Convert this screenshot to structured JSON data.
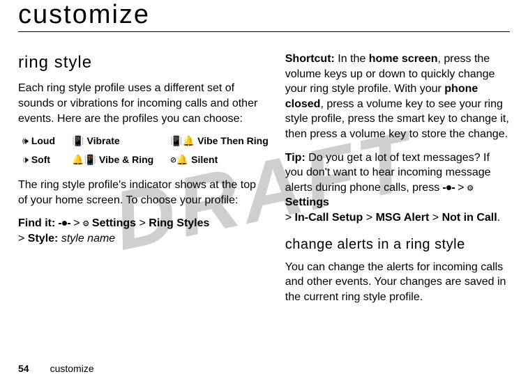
{
  "watermark": "DRAFT",
  "title": "customize",
  "left": {
    "heading": "ring style",
    "intro": "Each ring style profile uses a different set of sounds or vibrations for incoming calls and other events. Here are the profiles you can choose:",
    "styles": [
      {
        "icon": "loud-icon",
        "glyph": "🕪",
        "label": "Loud"
      },
      {
        "icon": "vibrate-icon",
        "glyph": "📳",
        "label": "Vibrate"
      },
      {
        "icon": "vibe-then-ring-icon",
        "glyph": "📳🔔",
        "label": "Vibe Then Ring"
      },
      {
        "icon": "soft-icon",
        "glyph": "🕩",
        "label": "Soft"
      },
      {
        "icon": "vibe-and-ring-icon",
        "glyph": "🔔📳",
        "label": "Vibe & Ring"
      },
      {
        "icon": "silent-icon",
        "glyph": "⊘🔔",
        "label": "Silent"
      }
    ],
    "indicator_text": "The ring style profile's indicator shows at the top of your home screen. To choose your profile:",
    "findit_label": "Find it:",
    "findit_sep1": ">",
    "findit_settings": "Settings",
    "findit_sep2": ">",
    "findit_ringstyles": "Ring Styles",
    "findit_sep3": ">",
    "findit_style": "Style:",
    "findit_stylename": "style name"
  },
  "right": {
    "shortcut_label": "Shortcut:",
    "shortcut_1": " In the ",
    "shortcut_home": "home screen",
    "shortcut_2": ", press the volume keys up or down to quickly change your ring style profile. With your ",
    "shortcut_closed": "phone closed",
    "shortcut_3": ", press a volume key to see your ring style profile, press the smart key to change it, then press a volume key to store the change.",
    "tip_label": "Tip:",
    "tip_1": " Do you get a lot of text messages? If you don't want to hear incoming message alerts during phone calls, press ",
    "tip_sep1": ">",
    "tip_settings": "Settings",
    "tip_sep2": ">",
    "tip_incall": "In-Call Setup",
    "tip_sep3": ">",
    "tip_msgalert": "MSG Alert",
    "tip_sep4": ">",
    "tip_notincall": "Not in Call",
    "tip_period": ".",
    "heading2": "change alerts in a ring style",
    "para2": "You can change the alerts for incoming calls and other events. Your changes are saved in the current ring style profile."
  },
  "footer": {
    "page": "54",
    "section": "customize"
  },
  "icons": {
    "settings_glyph": "⚙"
  }
}
